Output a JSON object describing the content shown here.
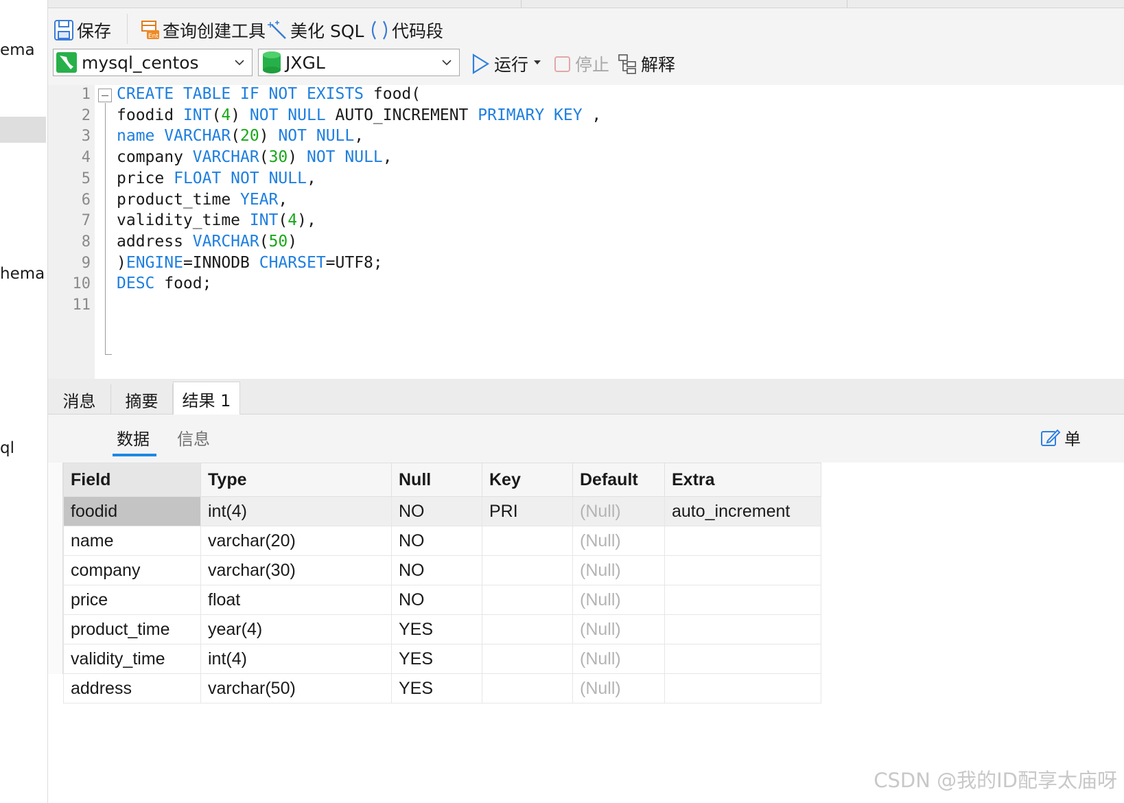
{
  "sidebar": {
    "fragments": [
      "ema",
      "hema",
      "ql"
    ]
  },
  "toolbar": {
    "save_label": "保存",
    "query_builder_label": "查询创建工具",
    "beautify_label": "美化 SQL",
    "snippet_label": "代码段",
    "connection_value": "mysql_centos",
    "database_value": "JXGL",
    "run_label": "运行",
    "stop_label": "停止",
    "explain_label": "解释"
  },
  "editor": {
    "line_numbers": [
      "1",
      "2",
      "3",
      "4",
      "5",
      "6",
      "7",
      "8",
      "9",
      "10",
      "11"
    ],
    "lines": [
      [
        {
          "t": "CREATE TABLE IF NOT EXISTS",
          "k": "kw"
        },
        {
          "t": " food("
        }
      ],
      [
        {
          "t": "foodid "
        },
        {
          "t": "INT",
          "k": "kw"
        },
        {
          "t": "("
        },
        {
          "t": "4",
          "k": "num"
        },
        {
          "t": ") "
        },
        {
          "t": "NOT NULL",
          "k": "kw"
        },
        {
          "t": " AUTO_INCREMENT "
        },
        {
          "t": "PRIMARY KEY",
          "k": "kw"
        },
        {
          "t": " ,"
        }
      ],
      [
        {
          "t": "name",
          "k": "kw"
        },
        {
          "t": " "
        },
        {
          "t": "VARCHAR",
          "k": "kw"
        },
        {
          "t": "("
        },
        {
          "t": "20",
          "k": "num"
        },
        {
          "t": ") "
        },
        {
          "t": "NOT NULL",
          "k": "kw"
        },
        {
          "t": ","
        }
      ],
      [
        {
          "t": "company "
        },
        {
          "t": "VARCHAR",
          "k": "kw"
        },
        {
          "t": "("
        },
        {
          "t": "30",
          "k": "num"
        },
        {
          "t": ") "
        },
        {
          "t": "NOT NULL",
          "k": "kw"
        },
        {
          "t": ","
        }
      ],
      [
        {
          "t": "price "
        },
        {
          "t": "FLOAT NOT NULL",
          "k": "kw"
        },
        {
          "t": ","
        }
      ],
      [
        {
          "t": "product_time "
        },
        {
          "t": "YEAR",
          "k": "kw"
        },
        {
          "t": ","
        }
      ],
      [
        {
          "t": "validity_time "
        },
        {
          "t": "INT",
          "k": "kw"
        },
        {
          "t": "("
        },
        {
          "t": "4",
          "k": "num"
        },
        {
          "t": "),"
        }
      ],
      [
        {
          "t": "address "
        },
        {
          "t": "VARCHAR",
          "k": "kw"
        },
        {
          "t": "("
        },
        {
          "t": "50",
          "k": "num"
        },
        {
          "t": ")"
        }
      ],
      [
        {
          "t": ")"
        },
        {
          "t": "ENGINE",
          "k": "kw"
        },
        {
          "t": "=INNODB "
        },
        {
          "t": "CHARSET",
          "k": "kw"
        },
        {
          "t": "=UTF8;"
        }
      ],
      [
        {
          "t": "DESC",
          "k": "kw"
        },
        {
          "t": " food;"
        }
      ],
      []
    ]
  },
  "result_tabs": [
    "消息",
    "摘要",
    "结果 1"
  ],
  "sub_tabs": [
    "数据",
    "信息"
  ],
  "right_edge_label": "单",
  "grid": {
    "columns": [
      "Field",
      "Type",
      "Null",
      "Key",
      "Default",
      "Extra"
    ],
    "rows": [
      [
        "foodid",
        "int(4)",
        "NO",
        "PRI",
        "(Null)",
        "auto_increment"
      ],
      [
        "name",
        "varchar(20)",
        "NO",
        "",
        "(Null)",
        ""
      ],
      [
        "company",
        "varchar(30)",
        "NO",
        "",
        "(Null)",
        ""
      ],
      [
        "price",
        "float",
        "NO",
        "",
        "(Null)",
        ""
      ],
      [
        "product_time",
        "year(4)",
        "YES",
        "",
        "(Null)",
        ""
      ],
      [
        "validity_time",
        "int(4)",
        "YES",
        "",
        "(Null)",
        ""
      ],
      [
        "address",
        "varchar(50)",
        "YES",
        "",
        "(Null)",
        ""
      ]
    ]
  },
  "watermark": "CSDN @我的ID配享太庙呀",
  "colors": {
    "keyword": "#1e7fe0",
    "number": "#18a818",
    "accent": "#1e88e5",
    "null_text": "#b4b4b4"
  }
}
